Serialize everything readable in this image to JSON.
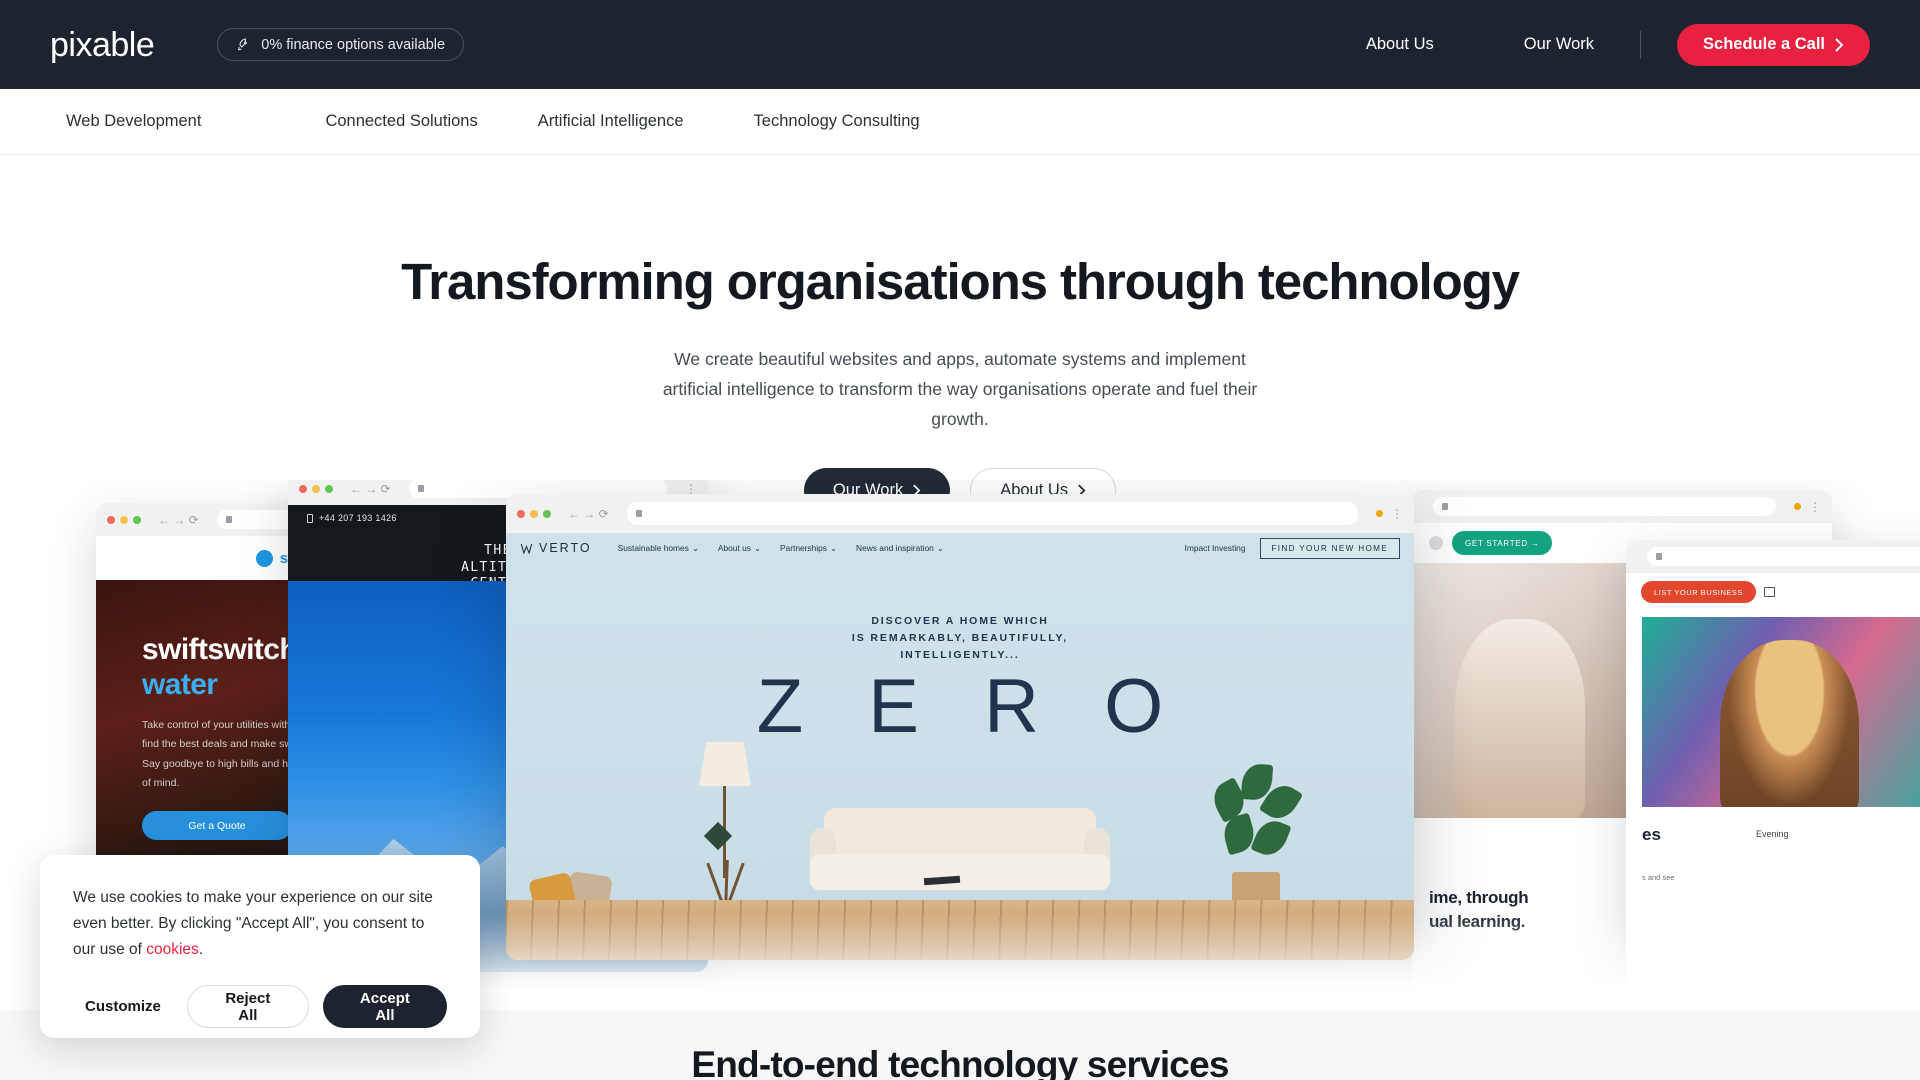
{
  "header": {
    "logo": "pixable",
    "finance_badge": {
      "icon": "rocket-icon",
      "label": "0% finance options available"
    },
    "nav": [
      {
        "label": "About Us"
      },
      {
        "label": "Our Work"
      }
    ],
    "cta": {
      "label": "Schedule a Call",
      "icon": "chevron-right-icon",
      "color": "#e8213f"
    },
    "background": "#1d2430"
  },
  "subnav": {
    "items": [
      {
        "label": "Web Development"
      },
      {
        "label": "Connected Solutions"
      },
      {
        "label": "Artificial Intelligence"
      },
      {
        "label": "Technology Consulting"
      }
    ]
  },
  "hero": {
    "title": "Transforming organisations through technology",
    "subtitle": "We create beautiful websites and apps, automate systems and implement artificial intelligence to transform the way organisations operate and fuel their growth.",
    "primary_button": {
      "label": "Our Work",
      "icon": "chevron-right-icon"
    },
    "secondary_button": {
      "label": "About Us",
      "icon": "chevron-right-icon"
    }
  },
  "showcase": {
    "swiftswitch": {
      "brand": "swiftswitch",
      "heading": "swiftswitch",
      "heading_accent": "water",
      "body": "Take control of your utilities with our service to find the best deals and make switching easy. Say goodbye to high bills and hello to peace of mind.",
      "button": "Get a Quote"
    },
    "altitude": {
      "phone": "+44 207 193 1426",
      "brand_line1": "THE",
      "brand_line2": "ALTITUDE",
      "brand_line3": "CENTRE"
    },
    "verto": {
      "logo": "VERTO",
      "nav": [
        {
          "label": "Sustainable homes",
          "caret": "⌄"
        },
        {
          "label": "About us",
          "caret": "⌄"
        },
        {
          "label": "Partnerships",
          "caret": "⌄"
        },
        {
          "label": "News and inspiration",
          "caret": "⌄"
        }
      ],
      "impact_link": "Impact Investing",
      "find_home_button": "FIND YOUR NEW HOME",
      "tagline_line1": "DISCOVER A HOME WHICH",
      "tagline_line2": "IS REMARKABLY, BEAUTIFULLY,",
      "tagline_line3": "INTELLIGENTLY...",
      "wordmark": "Z E R O"
    },
    "right_one": {
      "button": "GET STARTED  →",
      "text_line1": "ime, through",
      "text_line2": "ual learning."
    },
    "right_two": {
      "button": "LIST YOUR BUSINESS",
      "heading": "es",
      "subheading": "Evening",
      "paragraph": "s and see"
    }
  },
  "bottom_section": {
    "title": "End-to-end technology services"
  },
  "cookie_banner": {
    "text_before_link": "We use cookies to make your experience on our site even better. By clicking \"Accept All\", you consent to our use of ",
    "link_label": "cookies",
    "text_after_link": ".",
    "customize_label": "Customize",
    "reject_label": "Reject All",
    "accept_label": "Accept All"
  }
}
